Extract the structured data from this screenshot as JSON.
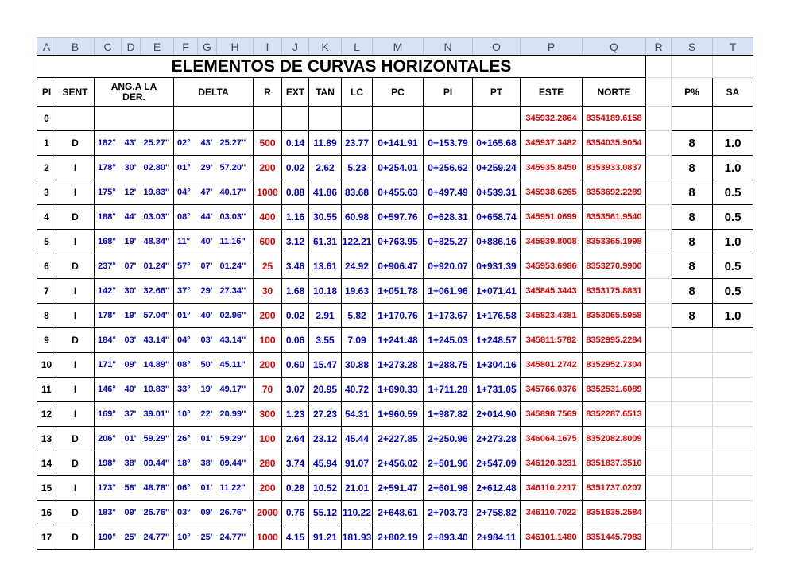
{
  "columns": [
    "A",
    "B",
    "C",
    "D",
    "E",
    "F",
    "G",
    "H",
    "I",
    "J",
    "K",
    "L",
    "M",
    "N",
    "O",
    "P",
    "Q",
    "R",
    "S",
    "T"
  ],
  "title": "ELEMENTOS DE CURVAS HORIZONTALES",
  "headers": {
    "pi": "PI",
    "sent": "SENT",
    "ang_line1": "ANG.A LA",
    "ang_line2": "DER.",
    "delta": "DELTA",
    "r": "R",
    "ext": "EXT",
    "tan": "TAN",
    "lc": "LC",
    "pc": "PC",
    "pi2": "PI",
    "pt": "PT",
    "este": "ESTE",
    "norte": "NORTE",
    "p": "P%",
    "sa": "SA"
  },
  "row0": {
    "pi": "0",
    "este": "345932.2864",
    "norte": "8354189.6158"
  },
  "rows": [
    {
      "pi": "1",
      "sent": "D",
      "ang_d": "182°",
      "ang_m": "43'",
      "ang_s": "25.27''",
      "del_d": "02°",
      "del_m": "43'",
      "del_s": "25.27''",
      "r": "500",
      "ext": "0.14",
      "tan": "11.89",
      "lc": "23.77",
      "pc": "0+141.91",
      "pi2": "0+153.79",
      "pt": "0+165.68",
      "este": "345937.3482",
      "norte": "8354035.9054",
      "p": "8",
      "sa": "1.0"
    },
    {
      "pi": "2",
      "sent": "I",
      "ang_d": "178°",
      "ang_m": "30'",
      "ang_s": "02.80''",
      "del_d": "01°",
      "del_m": "29'",
      "del_s": "57.20''",
      "r": "200",
      "ext": "0.02",
      "tan": "2.62",
      "lc": "5.23",
      "pc": "0+254.01",
      "pi2": "0+256.62",
      "pt": "0+259.24",
      "este": "345935.8450",
      "norte": "8353933.0837",
      "p": "8",
      "sa": "1.0"
    },
    {
      "pi": "3",
      "sent": "I",
      "ang_d": "175°",
      "ang_m": "12'",
      "ang_s": "19.83''",
      "del_d": "04°",
      "del_m": "47'",
      "del_s": "40.17''",
      "r": "1000",
      "ext": "0.88",
      "tan": "41.86",
      "lc": "83.68",
      "pc": "0+455.63",
      "pi2": "0+497.49",
      "pt": "0+539.31",
      "este": "345938.6265",
      "norte": "8353692.2289",
      "p": "8",
      "sa": "0.5"
    },
    {
      "pi": "4",
      "sent": "D",
      "ang_d": "188°",
      "ang_m": "44'",
      "ang_s": "03.03''",
      "del_d": "08°",
      "del_m": "44'",
      "del_s": "03.03''",
      "r": "400",
      "ext": "1.16",
      "tan": "30.55",
      "lc": "60.98",
      "pc": "0+597.76",
      "pi2": "0+628.31",
      "pt": "0+658.74",
      "este": "345951.0699",
      "norte": "8353561.9540",
      "p": "8",
      "sa": "0.5"
    },
    {
      "pi": "5",
      "sent": "I",
      "ang_d": "168°",
      "ang_m": "19'",
      "ang_s": "48.84''",
      "del_d": "11°",
      "del_m": "40'",
      "del_s": "11.16''",
      "r": "600",
      "ext": "3.12",
      "tan": "61.31",
      "lc": "122.21",
      "pc": "0+763.95",
      "pi2": "0+825.27",
      "pt": "0+886.16",
      "este": "345939.8008",
      "norte": "8353365.1998",
      "p": "8",
      "sa": "1.0"
    },
    {
      "pi": "6",
      "sent": "D",
      "ang_d": "237°",
      "ang_m": "07'",
      "ang_s": "01.24''",
      "del_d": "57°",
      "del_m": "07'",
      "del_s": "01.24''",
      "r": "25",
      "ext": "3.46",
      "tan": "13.61",
      "lc": "24.92",
      "pc": "0+906.47",
      "pi2": "0+920.07",
      "pt": "0+931.39",
      "este": "345953.6986",
      "norte": "8353270.9900",
      "p": "8",
      "sa": "0.5"
    },
    {
      "pi": "7",
      "sent": "I",
      "ang_d": "142°",
      "ang_m": "30'",
      "ang_s": "32.66''",
      "del_d": "37°",
      "del_m": "29'",
      "del_s": "27.34''",
      "r": "30",
      "ext": "1.68",
      "tan": "10.18",
      "lc": "19.63",
      "pc": "1+051.78",
      "pi2": "1+061.96",
      "pt": "1+071.41",
      "este": "345845.3443",
      "norte": "8353175.8831",
      "p": "8",
      "sa": "0.5"
    },
    {
      "pi": "8",
      "sent": "I",
      "ang_d": "178°",
      "ang_m": "19'",
      "ang_s": "57.04''",
      "del_d": "01°",
      "del_m": "40'",
      "del_s": "02.96''",
      "r": "200",
      "ext": "0.02",
      "tan": "2.91",
      "lc": "5.82",
      "pc": "1+170.76",
      "pi2": "1+173.67",
      "pt": "1+176.58",
      "este": "345823.4381",
      "norte": "8353065.5958",
      "p": "8",
      "sa": "1.0"
    },
    {
      "pi": "9",
      "sent": "D",
      "ang_d": "184°",
      "ang_m": "03'",
      "ang_s": "43.14''",
      "del_d": "04°",
      "del_m": "03'",
      "del_s": "43.14''",
      "r": "100",
      "ext": "0.06",
      "tan": "3.55",
      "lc": "7.09",
      "pc": "1+241.48",
      "pi2": "1+245.03",
      "pt": "1+248.57",
      "este": "345811.5782",
      "norte": "8352995.2284",
      "p": "",
      "sa": ""
    },
    {
      "pi": "10",
      "sent": "I",
      "ang_d": "171°",
      "ang_m": "09'",
      "ang_s": "14.89''",
      "del_d": "08°",
      "del_m": "50'",
      "del_s": "45.11''",
      "r": "200",
      "ext": "0.60",
      "tan": "15.47",
      "lc": "30.88",
      "pc": "1+273.28",
      "pi2": "1+288.75",
      "pt": "1+304.16",
      "este": "345801.2742",
      "norte": "8352952.7304",
      "p": "",
      "sa": ""
    },
    {
      "pi": "11",
      "sent": "I",
      "ang_d": "146°",
      "ang_m": "40'",
      "ang_s": "10.83''",
      "del_d": "33°",
      "del_m": "19'",
      "del_s": "49.17''",
      "r": "70",
      "ext": "3.07",
      "tan": "20.95",
      "lc": "40.72",
      "pc": "1+690.33",
      "pi2": "1+711.28",
      "pt": "1+731.05",
      "este": "345766.0376",
      "norte": "8352531.6089",
      "p": "",
      "sa": ""
    },
    {
      "pi": "12",
      "sent": "I",
      "ang_d": "169°",
      "ang_m": "37'",
      "ang_s": "39.01''",
      "del_d": "10°",
      "del_m": "22'",
      "del_s": "20.99''",
      "r": "300",
      "ext": "1.23",
      "tan": "27.23",
      "lc": "54.31",
      "pc": "1+960.59",
      "pi2": "1+987.82",
      "pt": "2+014.90",
      "este": "345898.7569",
      "norte": "8352287.6513",
      "p": "",
      "sa": ""
    },
    {
      "pi": "13",
      "sent": "D",
      "ang_d": "206°",
      "ang_m": "01'",
      "ang_s": "59.29''",
      "del_d": "26°",
      "del_m": "01'",
      "del_s": "59.29''",
      "r": "100",
      "ext": "2.64",
      "tan": "23.12",
      "lc": "45.44",
      "pc": "2+227.85",
      "pi2": "2+250.96",
      "pt": "2+273.28",
      "este": "346064.1675",
      "norte": "8352082.8009",
      "p": "",
      "sa": ""
    },
    {
      "pi": "14",
      "sent": "D",
      "ang_d": "198°",
      "ang_m": "38'",
      "ang_s": "09.44''",
      "del_d": "18°",
      "del_m": "38'",
      "del_s": "09.44''",
      "r": "280",
      "ext": "3.74",
      "tan": "45.94",
      "lc": "91.07",
      "pc": "2+456.02",
      "pi2": "2+501.96",
      "pt": "2+547.09",
      "este": "346120.3231",
      "norte": "8351837.3510",
      "p": "",
      "sa": ""
    },
    {
      "pi": "15",
      "sent": "I",
      "ang_d": "173°",
      "ang_m": "58'",
      "ang_s": "48.78''",
      "del_d": "06°",
      "del_m": "01'",
      "del_s": "11.22''",
      "r": "200",
      "ext": "0.28",
      "tan": "10.52",
      "lc": "21.01",
      "pc": "2+591.47",
      "pi2": "2+601.98",
      "pt": "2+612.48",
      "este": "346110.2217",
      "norte": "8351737.0207",
      "p": "",
      "sa": ""
    },
    {
      "pi": "16",
      "sent": "D",
      "ang_d": "183°",
      "ang_m": "09'",
      "ang_s": "26.76''",
      "del_d": "03°",
      "del_m": "09'",
      "del_s": "26.76''",
      "r": "2000",
      "ext": "0.76",
      "tan": "55.12",
      "lc": "110.22",
      "pc": "2+648.61",
      "pi2": "2+703.73",
      "pt": "2+758.82",
      "este": "346110.7022",
      "norte": "8351635.2584",
      "p": "",
      "sa": ""
    },
    {
      "pi": "17",
      "sent": "D",
      "ang_d": "190°",
      "ang_m": "25'",
      "ang_s": "24.77''",
      "del_d": "10°",
      "del_m": "25'",
      "del_s": "24.77''",
      "r": "1000",
      "ext": "4.15",
      "tan": "91.21",
      "lc": "181.93",
      "pc": "2+802.19",
      "pi2": "2+893.40",
      "pt": "2+984.11",
      "este": "346101.1480",
      "norte": "8351445.7983",
      "p": "",
      "sa": ""
    }
  ]
}
